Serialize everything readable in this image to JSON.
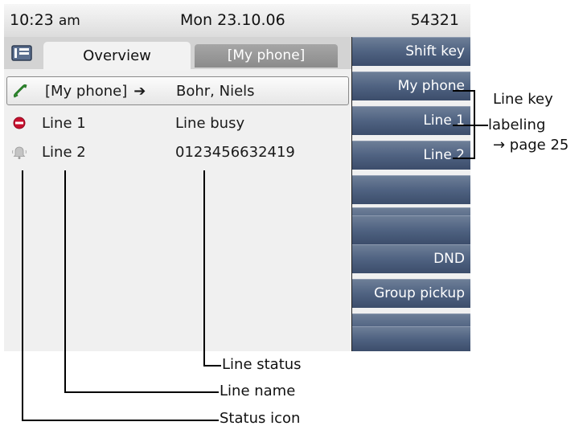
{
  "status_bar": {
    "time": "10:23",
    "am_pm": "am",
    "date": "Mon 23.10.06",
    "number": "54321"
  },
  "tabs": {
    "overview": "Overview",
    "my_phone": "[My phone]"
  },
  "lines": [
    {
      "icon": "phone-handset-icon",
      "name": "[My phone]",
      "value": "Bohr, Niels",
      "selected": true
    },
    {
      "icon": "busy-icon",
      "name": "Line 1",
      "value": "Line busy"
    },
    {
      "icon": "bell-icon",
      "name": "Line 2",
      "value": "0123456632419"
    }
  ],
  "keys": [
    "Shift key",
    "My phone",
    "Line 1",
    "Line 2",
    "",
    "",
    "",
    "DND",
    "Group pickup",
    "",
    ""
  ],
  "callouts": {
    "line_key_labeling": [
      "Line key",
      "labeling"
    ],
    "page_ref": "→ page 25",
    "line_status": "Line status",
    "line_name": "Line name",
    "status_icon": "Status icon"
  },
  "colors": {
    "key_panel": "#4f6281",
    "busy_icon": "#c8102e",
    "phone_icon": "#2e8b2e",
    "screen_bg": "#f0f0f0"
  }
}
